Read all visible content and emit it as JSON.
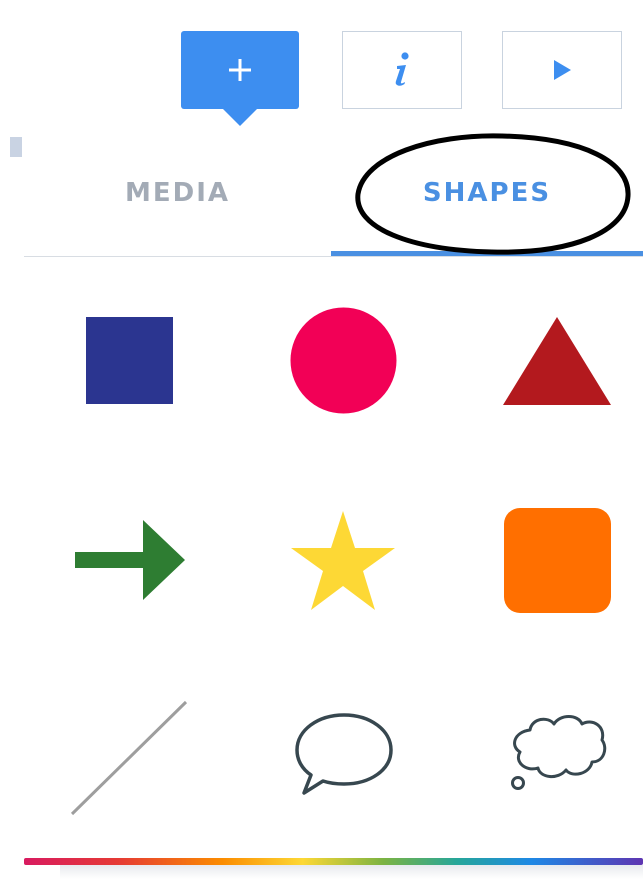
{
  "toolbar": {
    "add_icon": "plus-icon",
    "info_icon": "info-icon",
    "play_icon": "play-icon",
    "accent_color": "#3d8ef0"
  },
  "tabs": [
    {
      "label": "MEDIA",
      "active": false
    },
    {
      "label": "SHAPES",
      "active": true
    }
  ],
  "colors": {
    "active_tab": "#4a90e2",
    "inactive_tab": "#a3abb6"
  },
  "shapes": [
    {
      "name": "square",
      "color": "#2b3590"
    },
    {
      "name": "circle",
      "color": "#f20056"
    },
    {
      "name": "triangle",
      "color": "#b3191e"
    },
    {
      "name": "arrow",
      "color": "#2e7d32"
    },
    {
      "name": "star",
      "color": "#fdd835"
    },
    {
      "name": "rounded-square",
      "color": "#ff6f00"
    },
    {
      "name": "line",
      "color": "#9e9e9e"
    },
    {
      "name": "speech-bubble",
      "color": "#37474f"
    },
    {
      "name": "thought-bubble",
      "color": "#37474f"
    }
  ]
}
